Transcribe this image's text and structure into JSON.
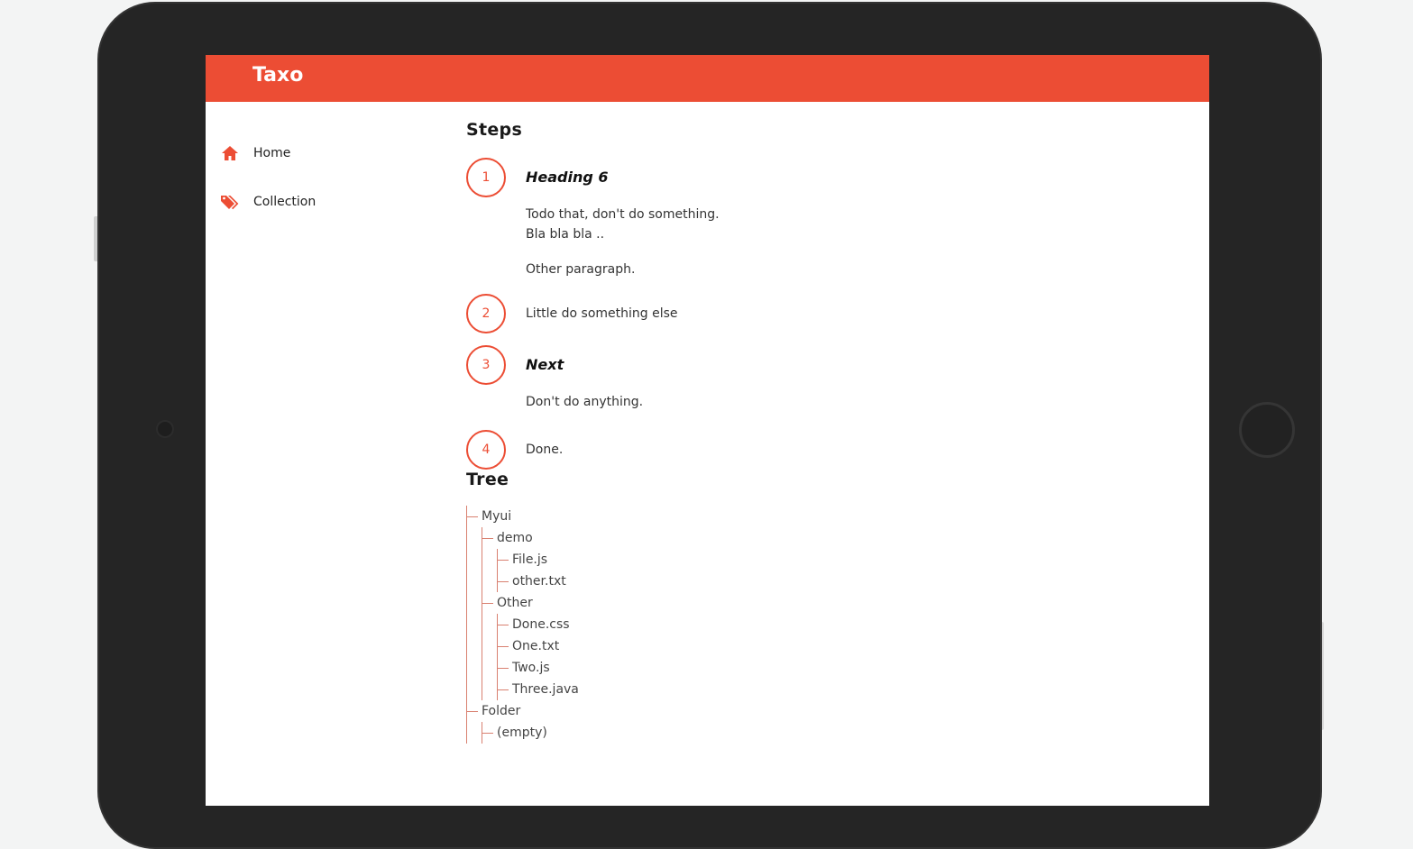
{
  "app": {
    "title": "Taxo",
    "accent_color": "#ec4d34"
  },
  "sidebar": {
    "items": [
      {
        "label": "Home",
        "icon": "home-icon"
      },
      {
        "label": "Collection",
        "icon": "tag-icon"
      }
    ]
  },
  "steps_section": {
    "title": "Steps",
    "steps": [
      {
        "number": "1",
        "heading": "Heading 6",
        "paragraphs": [
          "Todo that, don't do something.",
          "Bla bla bla ..",
          "Other paragraph."
        ]
      },
      {
        "number": "2",
        "text": "Little do something else"
      },
      {
        "number": "3",
        "heading": "Next",
        "paragraphs": [
          "Don't do anything."
        ]
      },
      {
        "number": "4",
        "text": "Done."
      }
    ]
  },
  "tree_section": {
    "title": "Tree",
    "root": "Myui",
    "demo": "demo",
    "demo_files": [
      "File.js",
      "other.txt"
    ],
    "other": "Other",
    "other_files": [
      "Done.css",
      "One.txt",
      "Two.js",
      "Three.java"
    ],
    "folder": "Folder",
    "folder_empty": "(empty)"
  }
}
